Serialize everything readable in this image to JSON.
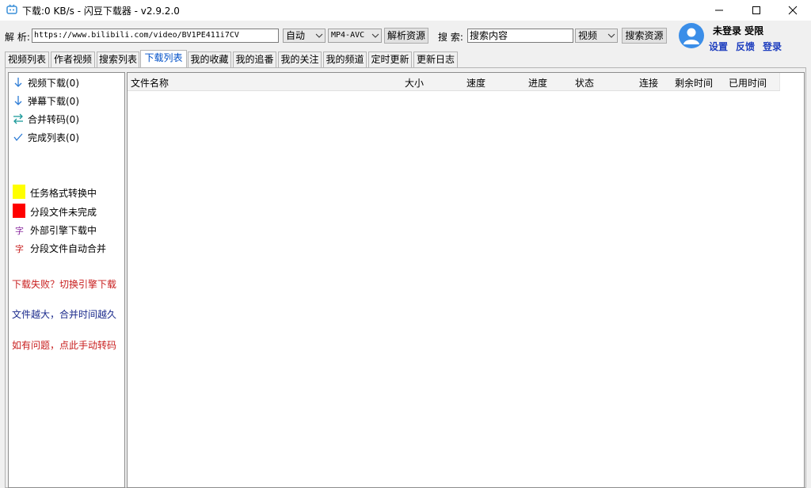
{
  "window": {
    "title": "下载:0 KB/s - 闪豆下载器 - v2.9.2.0",
    "controls": [
      "minimize-icon",
      "maximize-icon",
      "close-icon"
    ]
  },
  "toolbar": {
    "parse_label": "解 析:",
    "url_value": "https://www.bilibili.com/video/BV1PE411i7CV",
    "quality_select": "自动",
    "format_select": "MP4-AVC",
    "parse_button": "解析资源",
    "search_label": "搜 索:",
    "search_value": "搜索内容",
    "search_type_select": "视频",
    "search_button": "搜索资源"
  },
  "user": {
    "status": "未登录  受限",
    "links": [
      "设置",
      "反馈",
      "登录"
    ]
  },
  "tabs": [
    {
      "label": "视频列表",
      "active": false
    },
    {
      "label": "作者视频",
      "active": false
    },
    {
      "label": "搜索列表",
      "active": false
    },
    {
      "label": "下载列表",
      "active": true
    },
    {
      "label": "我的收藏",
      "active": false
    },
    {
      "label": "我的追番",
      "active": false
    },
    {
      "label": "我的关注",
      "active": false
    },
    {
      "label": "我的频道",
      "active": false
    },
    {
      "label": "定时更新",
      "active": false
    },
    {
      "label": "更新日志",
      "active": false
    }
  ],
  "sidebar": {
    "categories": [
      {
        "label": "视频下载(0)",
        "icon": "arrow-down-icon"
      },
      {
        "label": "弹幕下载(0)",
        "icon": "arrow-down-icon"
      },
      {
        "label": "合并转码(0)",
        "icon": "swap-arrows-icon"
      },
      {
        "label": "完成列表(0)",
        "icon": "checkmark-icon"
      }
    ],
    "legend": [
      {
        "label": "任务格式转换中",
        "color": "#ffff00"
      },
      {
        "label": "分段文件未完成",
        "color": "#ff0000"
      },
      {
        "label": "外部引擎下载中",
        "glyph": "字",
        "color": "#8b2ca0"
      },
      {
        "label": "分段文件自动合并",
        "glyph": "字",
        "color": "#c81e1e"
      }
    ],
    "tips": [
      {
        "text": "下载失败？切换引擎下载",
        "color": "#c81e1e"
      },
      {
        "text": "文件越大，合并时间越久",
        "color": "#1a2a8c"
      },
      {
        "text": "如有问题，点此手动转码",
        "color": "#c81e1e"
      }
    ]
  },
  "download_table": {
    "columns": [
      "文件名称",
      "大小",
      "速度",
      "进度",
      "状态",
      "连接",
      "剩余时间",
      "已用时间"
    ],
    "rows": []
  },
  "colors": {
    "accent_blue": "#1f3fbf",
    "active_tab_text": "#0050c8",
    "icon_blue": "#2b7bd6"
  }
}
